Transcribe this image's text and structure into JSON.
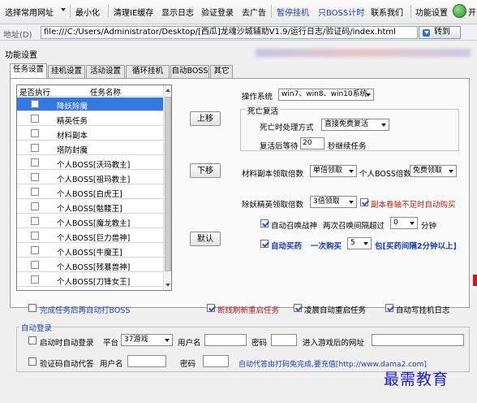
{
  "toolbar": {
    "items": [
      {
        "label": "选择常用网址",
        "has_arrow": true
      },
      {
        "label": "最小化"
      },
      {
        "label": "清理IE缓存"
      },
      {
        "label": "显示日志"
      },
      {
        "label": "验证登录"
      },
      {
        "label": "去广告"
      },
      {
        "label": "暂停挂机",
        "blue": true
      },
      {
        "label": "只BOSS计时",
        "blue": true
      },
      {
        "label": "联系我们"
      },
      {
        "label": "功能设置"
      },
      {
        "label": "开"
      }
    ]
  },
  "address_bar": {
    "label": "地址(D)",
    "url": "file:///C:/Users/Administrator/Desktop/[西瓜]龙魂沙城辅助V1.9/运行日志/验证码/index.html",
    "go_label": "转到"
  },
  "panel": {
    "title": "功能设置",
    "tabs": [
      "任务设置",
      "挂机设置",
      "活动设置",
      "循环挂机",
      "自动BOSS",
      "其它"
    ],
    "active_tab": 0
  },
  "task_list": {
    "headers": [
      "是否执行",
      "任务名称"
    ],
    "rows": [
      {
        "name": "降妖除魔",
        "selected": true
      },
      {
        "name": "精英任务"
      },
      {
        "name": "材料副本"
      },
      {
        "name": "塔防封魔"
      },
      {
        "name": "个人BOSS[沃玛教主]"
      },
      {
        "name": "个人BOSS[祖玛教主]"
      },
      {
        "name": "个人BOSS[白虎王]"
      },
      {
        "name": "个人BOSS[骷髅王]"
      },
      {
        "name": "个人BOSS[魔龙教主]"
      },
      {
        "name": "个人BOSS[巨力兽神]"
      },
      {
        "name": "个人BOSS[牛魔王]"
      },
      {
        "name": "个人BOSS[残暴兽神]"
      },
      {
        "name": "个人BOSS[刀锋女王]"
      }
    ]
  },
  "buttons": {
    "move_up": "上移",
    "move_down": "下移",
    "default": "默认"
  },
  "settings": {
    "os_label": "操作系统",
    "os_value": "win7、win8、win10系统",
    "death_group_title": "死亡复活",
    "death_method_label": "死亡时处理方式",
    "death_method_value": "直接免费复活",
    "revive_wait_label": "复活后等待",
    "revive_wait_value": "20",
    "revive_wait_suffix": "秒继续任务",
    "material_reward_label": "材料副本领取倍数",
    "material_reward_value": "单倍领取",
    "personal_boss_label": "个人BOSS倍数",
    "personal_boss_value": "免费领取",
    "elite_reward_label": "除妖精英领取倍数",
    "elite_reward_value": "3倍领取",
    "scroll_buy_label": "副本卷轴不足时自动购买",
    "summon_label": "自动召唤战神",
    "summon_interval_label": "两次召唤间隔超过",
    "summon_interval_value": "0",
    "summon_interval_suffix": "分钟",
    "buy_potion_label": "自动买药",
    "buy_once_label": "一次购买",
    "buy_once_value": "5",
    "buy_suffix": "包[买药间隔2分钟以上]"
  },
  "bottom_checks": {
    "auto_boss_after": "完成任务后再自动打BOSS",
    "refresh_restart": "断线刷新重启任务",
    "morning_restart": "凌晨自动重启任务",
    "auto_log": "自动写挂机日志"
  },
  "auto_login": {
    "group_title": "自动登录",
    "startup_login_label": "启动时自动登录",
    "platform_label": "平台",
    "platform_value": "37游戏",
    "username_label": "用户名",
    "password_label": "密码",
    "game_url_label": "进入游戏后的网址",
    "captcha_label": "验证码自动代答",
    "captcha_username_label": "用户名",
    "captcha_password_label": "密码",
    "captcha_link": "自动代答由打码兔完成,要充值[http://www.dama2.com]"
  },
  "watermark": "最需教育",
  "colors": {
    "accent_blue": "#1a3fb8",
    "selected_row": "#3377e0",
    "red_text": "#c21c1c",
    "watermark": "#1b1bd8"
  }
}
